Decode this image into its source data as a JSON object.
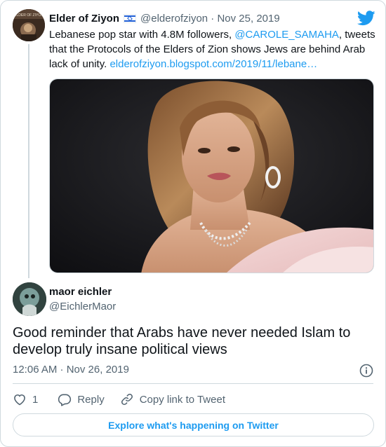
{
  "quoted_tweet": {
    "author_name": "Elder of Ziyon",
    "flag_icon": "israel-flag-icon",
    "handle_date": "@elderofziyon · Nov 25, 2019",
    "text_before": "Lebanese pop star with 4.8M followers, ",
    "mention": "@CAROLE_SAMAHA",
    "text_after": ", tweets that the Protocols of the Elders of Zion shows Jews are behind Arab lack of unity. ",
    "link": "elderofziyon.blogspot.com/2019/11/lebane…",
    "avatar_label": "ELDER OF ZIYON"
  },
  "tweet": {
    "author_name": "maor eichler",
    "handle": "@EichlerMaor",
    "text": "Good reminder that Arabs have never needed Islam to develop truly insane political views",
    "timestamp": "12:06 AM · Nov 26, 2019"
  },
  "actions": {
    "like_count": "1",
    "reply_label": "Reply",
    "copy_link_label": "Copy link to Tweet"
  },
  "footer": {
    "explore_label": "Explore what's happening on Twitter"
  },
  "colors": {
    "accent": "#1d9bf0",
    "text": "#0f1419",
    "muted": "#536471",
    "border": "#cfd9de"
  },
  "icons": [
    "twitter-bird-icon",
    "israel-flag-icon",
    "info-icon",
    "heart-icon",
    "reply-icon",
    "link-icon"
  ]
}
